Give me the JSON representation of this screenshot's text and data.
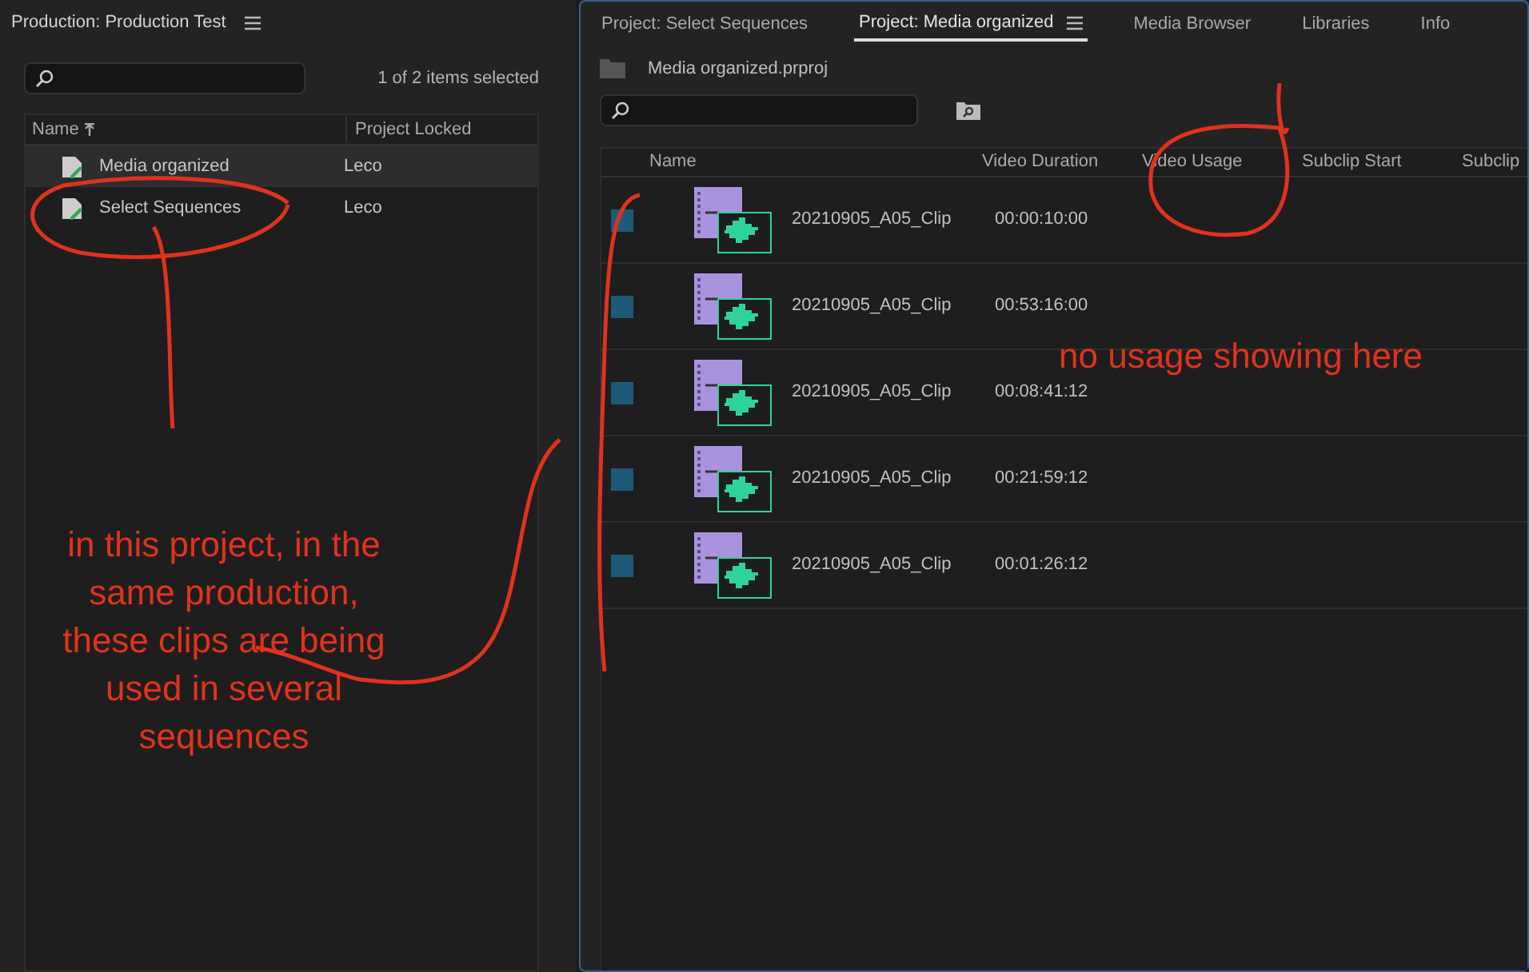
{
  "production_panel": {
    "title": "Production: Production Test",
    "selection_status": "1 of 2 items selected",
    "columns": [
      "Name",
      "Project Locked"
    ],
    "rows": [
      {
        "name": "Media organized",
        "locked_by": "Leco",
        "selected": true
      },
      {
        "name": "Select Sequences",
        "locked_by": "Leco",
        "selected": false
      }
    ]
  },
  "project_panel": {
    "tabs": [
      {
        "label": "Project: Select Sequences",
        "selected": false
      },
      {
        "label": "Project: Media organized",
        "selected": true
      },
      {
        "label": "Media Browser",
        "selected": false
      },
      {
        "label": "Libraries",
        "selected": false
      },
      {
        "label": "Info",
        "selected": false
      }
    ],
    "project_file": "Media organized.prproj",
    "columns": [
      "Name",
      "Video Duration",
      "Video Usage",
      "Subclip Start",
      "Subclip"
    ],
    "rows": [
      {
        "name": "20210905_A05_Clip",
        "duration": "00:00:10:00",
        "color": "#1e5a78"
      },
      {
        "name": "20210905_A05_Clip",
        "duration": "00:53:16:00",
        "color": "#1e5a78"
      },
      {
        "name": "20210905_A05_Clip",
        "duration": "00:08:41:12",
        "color": "#1e5a78"
      },
      {
        "name": "20210905_A05_Clip",
        "duration": "00:21:59:12",
        "color": "#1e5a78"
      },
      {
        "name": "20210905_A05_Clip",
        "duration": "00:01:26:12",
        "color": "#1e5a78"
      }
    ]
  },
  "annotations": [
    {
      "text": "in this project, in the same production, these clips are being used in several sequences"
    },
    {
      "text": "no usage showing here"
    }
  ]
}
